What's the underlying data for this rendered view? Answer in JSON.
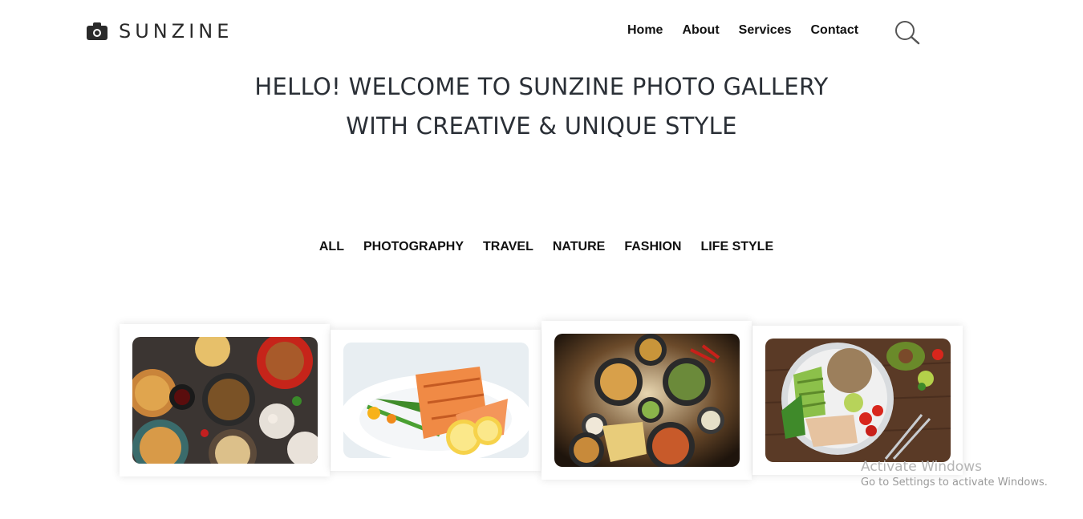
{
  "brand": {
    "name": "SUNZINE",
    "icon": "camera-icon"
  },
  "nav": {
    "items": [
      "Home",
      "About",
      "Services",
      "Contact"
    ],
    "search_icon": "search-icon"
  },
  "hero": {
    "line1": "HELLO! WELCOME TO SUNZINE PHOTO GALLERY",
    "line2": "WITH CREATIVE & UNIQUE STYLE"
  },
  "filters": [
    "ALL",
    "PHOTOGRAPHY",
    "TRAVEL",
    "NATURE",
    "FASHION",
    "LIFE STYLE"
  ],
  "gallery": [
    {
      "icon": "asian-food-spread-photo"
    },
    {
      "icon": "grilled-salmon-plate-photo"
    },
    {
      "icon": "indian-food-spread-photo"
    },
    {
      "icon": "chicken-salad-bowl-photo"
    }
  ],
  "watermark": {
    "title": "Activate Windows",
    "subtitle": "Go to Settings to activate Windows."
  },
  "colors": {
    "text": "#111111",
    "heading": "#2a2f36",
    "background": "#ffffff"
  }
}
